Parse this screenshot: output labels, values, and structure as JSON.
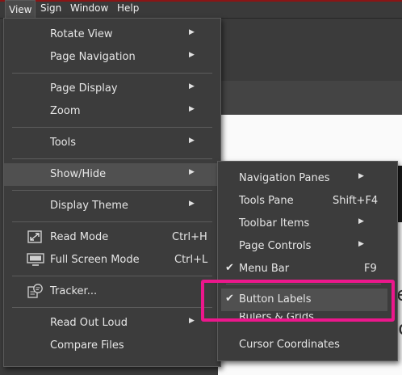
{
  "menubar": {
    "items": [
      "View",
      "Sign",
      "Window",
      "Help"
    ]
  },
  "view_menu": {
    "rotate_view": "Rotate View",
    "page_navigation": "Page Navigation",
    "page_display": "Page Display",
    "zoom": "Zoom",
    "tools": "Tools",
    "show_hide": "Show/Hide",
    "display_theme": "Display Theme",
    "read_mode": "Read Mode",
    "read_mode_shortcut": "Ctrl+H",
    "full_screen_mode": "Full Screen Mode",
    "full_screen_shortcut": "Ctrl+L",
    "tracker": "Tracker...",
    "read_out_loud": "Read Out Loud",
    "compare_files": "Compare Files"
  },
  "show_hide_menu": {
    "navigation_panes": "Navigation Panes",
    "tools_pane": "Tools Pane",
    "tools_pane_shortcut": "Shift+F4",
    "toolbar_items": "Toolbar Items",
    "page_controls": "Page Controls",
    "menu_bar": "Menu Bar",
    "menu_bar_shortcut": "F9",
    "button_labels": "Button Labels",
    "rulers_grids": "Rulers & Grids",
    "cursor_coordinates": "Cursor Coordinates"
  },
  "background": {
    "doc_text_1": "ce",
    "doc_text_2": "no"
  },
  "colors": {
    "menu_bg": "#3c3c3c",
    "highlight_box": "#ec178c",
    "document_bg": "#fafafa",
    "title_bar_accent": "#8a1515"
  },
  "icons": {
    "arrow": "submenu-arrow-icon",
    "check": "checkmark-icon",
    "read_mode": "read-mode-icon",
    "full_screen": "full-screen-icon",
    "tracker": "tracker-icon"
  }
}
